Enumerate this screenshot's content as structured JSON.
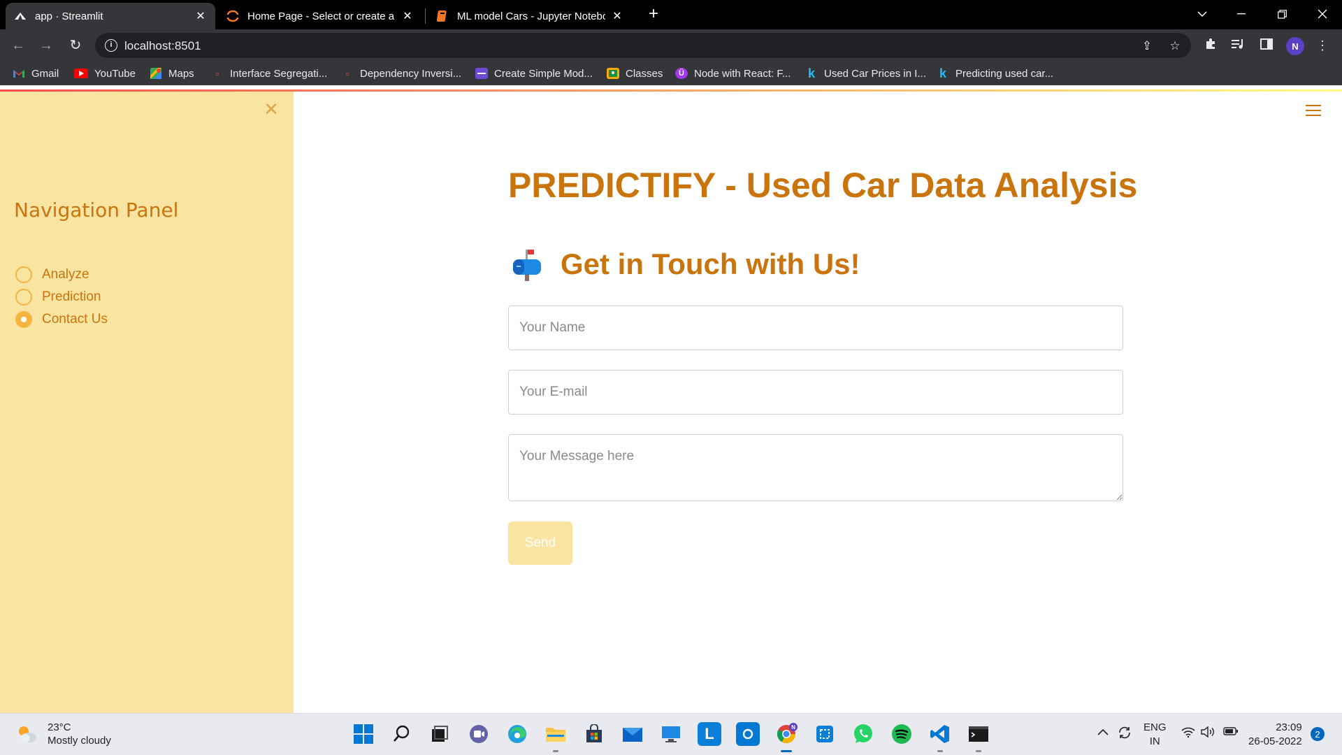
{
  "browser": {
    "tabs": [
      {
        "title": "app · Streamlit",
        "active": true
      },
      {
        "title": "Home Page - Select or create a n",
        "active": false
      },
      {
        "title": "ML model Cars - Jupyter Notebo",
        "active": false
      }
    ],
    "new_tab": "+",
    "url": "localhost:8501",
    "profile_initial": "N",
    "bookmarks": [
      {
        "label": "Gmail",
        "icon": "gmail-icon"
      },
      {
        "label": "YouTube",
        "icon": "youtube-icon"
      },
      {
        "label": "Maps",
        "icon": "maps-icon"
      },
      {
        "label": "Interface Segregati...",
        "icon": "page-icon"
      },
      {
        "label": "Dependency Inversi...",
        "icon": "page-icon"
      },
      {
        "label": "Create Simple Mod...",
        "icon": "page-icon"
      },
      {
        "label": "Classes",
        "icon": "classroom-icon"
      },
      {
        "label": "Node with React: F...",
        "icon": "udemy-icon"
      },
      {
        "label": "Used Car Prices in I...",
        "icon": "kaggle-icon"
      },
      {
        "label": "Predicting used car...",
        "icon": "kaggle-icon"
      }
    ]
  },
  "sidebar": {
    "title": "Navigation Panel",
    "options": [
      {
        "label": "Analyze",
        "selected": false
      },
      {
        "label": "Prediction",
        "selected": false
      },
      {
        "label": "Contact Us",
        "selected": true
      }
    ]
  },
  "main": {
    "title": "PREDICTIFY - Used Car Data Analysis",
    "subheading": "Get in Touch with Us!",
    "subheading_icon": "mailbox-icon",
    "name_placeholder": "Your Name",
    "email_placeholder": "Your E-mail",
    "message_placeholder": "Your Message here",
    "send_label": "Send"
  },
  "taskbar": {
    "weather_temp": "23°C",
    "weather_desc": "Mostly cloudy",
    "lang_line1": "ENG",
    "lang_line2": "IN",
    "time": "23:09",
    "date": "26-05-2022",
    "notification_count": "2"
  },
  "colors": {
    "accent": "#c9740c",
    "sidebar_bg": "#f9e5a1",
    "radio": "#f4b540"
  }
}
